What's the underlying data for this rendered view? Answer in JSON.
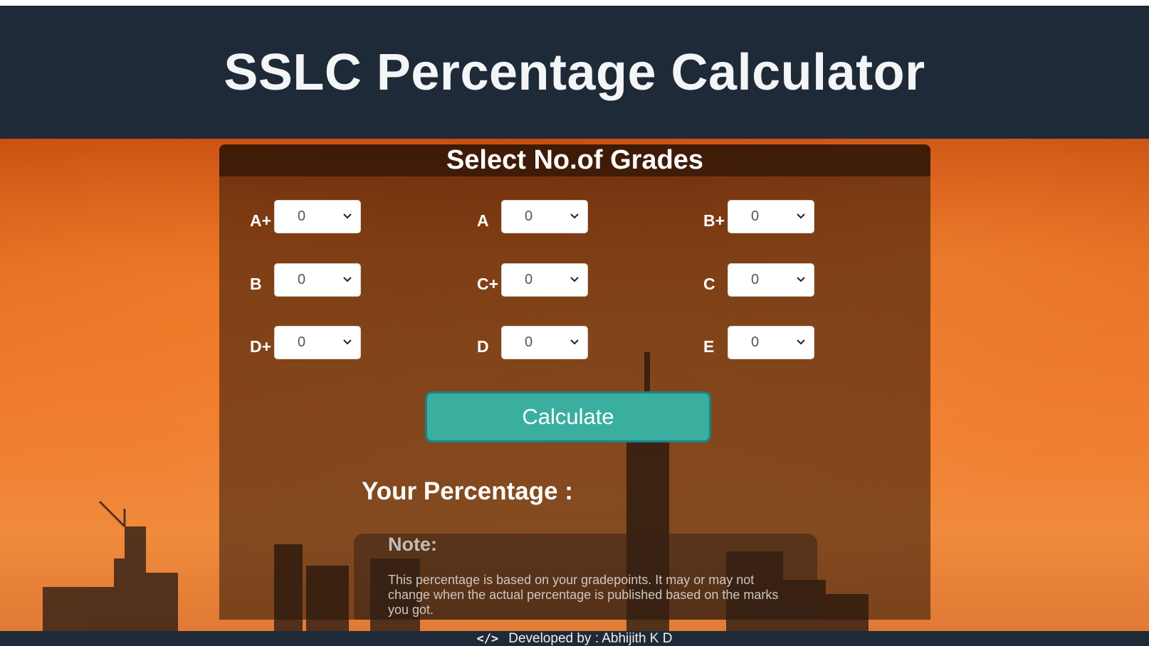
{
  "header": {
    "title": "SSLC Percentage Calculator"
  },
  "panel": {
    "title": "Select No.of Grades"
  },
  "grades": [
    {
      "label": "A+",
      "value": "0"
    },
    {
      "label": "A",
      "value": "0"
    },
    {
      "label": "B+",
      "value": "0"
    },
    {
      "label": "B",
      "value": "0"
    },
    {
      "label": "C+",
      "value": "0"
    },
    {
      "label": "C",
      "value": "0"
    },
    {
      "label": "D+",
      "value": "0"
    },
    {
      "label": "D",
      "value": "0"
    },
    {
      "label": "E",
      "value": "0"
    }
  ],
  "calculate_label": "Calculate",
  "result_label": "Your Percentage :",
  "note": {
    "title": "Note:",
    "text": "This percentage is based on your gradepoints. It may or may not change when the actual percentage is published based on the marks you got."
  },
  "footer": {
    "icon": "code-icon",
    "text": "Developed by : Abhijith K D"
  },
  "colors": {
    "header_bg": "#1e2a37",
    "button_bg": "#3aafa0",
    "button_border": "#1f7f86",
    "background_orange": "#ef7a2c"
  }
}
